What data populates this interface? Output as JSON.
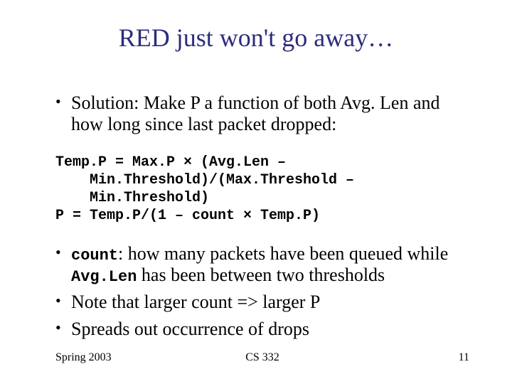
{
  "title": "RED just won't go away…",
  "bullet1": "Solution: Make P a function of both Avg. Len and how long since last packet dropped:",
  "code": {
    "line1": "Temp.P = Max.P × (Avg.Len –",
    "line2": "Min.Threshold)/(Max.Threshold – Min.Threshold)",
    "line3": "P = Temp.P/(1 – count × Temp.P)"
  },
  "bullet2": {
    "code1": "count",
    "text1": ": how many packets have been queued while ",
    "code2": "Avg.Len",
    "text2": " has been between two thresholds"
  },
  "bullet3": "Note that larger count => larger P",
  "bullet4": "Spreads out occurrence of drops",
  "footer": {
    "left": "Spring 2003",
    "center": "CS 332",
    "right": "11"
  }
}
